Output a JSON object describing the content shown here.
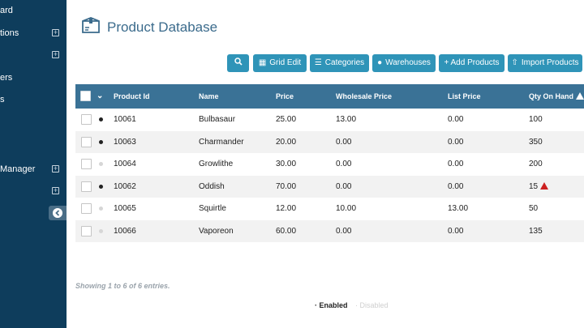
{
  "sidebar": {
    "items": [
      {
        "label": "ard",
        "has_expand": false
      },
      {
        "label": "tions",
        "has_expand": true
      },
      {
        "label": "",
        "has_expand": true
      },
      {
        "label": "ers",
        "has_expand": false
      },
      {
        "label": "s",
        "has_expand": false
      },
      {
        "label": "Manager",
        "has_expand": true
      },
      {
        "label": "",
        "has_expand": true
      }
    ],
    "expand_glyph": "+",
    "collapse_icon": "arrow-left-circle-icon",
    "background": "#0e3d5c"
  },
  "page": {
    "title": "Product Database",
    "title_icon": "box-icon"
  },
  "toolbar": {
    "search_icon": "search-icon",
    "grid_edit": "Grid Edit",
    "categories": "Categories",
    "warehouses": "Warehouses",
    "add_products": "+ Add Products",
    "import_products": "Import Products",
    "accent": "#2f94b8"
  },
  "table": {
    "header_color": "#3a7296",
    "columns": {
      "product_id": "Product Id",
      "name": "Name",
      "price": "Price",
      "wholesale_price": "Wholesale Price",
      "list_price": "List Price",
      "qty_on_hand": "Qty On Hand"
    },
    "rows": [
      {
        "product_id": "10061",
        "name": "Bulbasaur",
        "price": "25.00",
        "wholesale_price": "13.00",
        "list_price": "0.00",
        "qty_on_hand": "100",
        "enabled": true,
        "warning": false
      },
      {
        "product_id": "10063",
        "name": "Charmander",
        "price": "20.00",
        "wholesale_price": "0.00",
        "list_price": "0.00",
        "qty_on_hand": "350",
        "enabled": true,
        "warning": false
      },
      {
        "product_id": "10064",
        "name": "Growlithe",
        "price": "30.00",
        "wholesale_price": "0.00",
        "list_price": "0.00",
        "qty_on_hand": "200",
        "enabled": false,
        "warning": false
      },
      {
        "product_id": "10062",
        "name": "Oddish",
        "price": "70.00",
        "wholesale_price": "0.00",
        "list_price": "0.00",
        "qty_on_hand": "15",
        "enabled": true,
        "warning": true
      },
      {
        "product_id": "10065",
        "name": "Squirtle",
        "price": "12.00",
        "wholesale_price": "10.00",
        "list_price": "13.00",
        "qty_on_hand": "50",
        "enabled": false,
        "warning": false
      },
      {
        "product_id": "10066",
        "name": "Vaporeon",
        "price": "60.00",
        "wholesale_price": "0.00",
        "list_price": "0.00",
        "qty_on_hand": "135",
        "enabled": false,
        "warning": false
      }
    ],
    "enabled_dot_color": "#222222",
    "disabled_dot_color": "#d6d6d6",
    "warning_color": "#cc2020"
  },
  "footer": {
    "entries": "Showing 1 to 6 of 6 entries.",
    "legend_enabled": "Enabled",
    "legend_disabled": "Disabled"
  }
}
